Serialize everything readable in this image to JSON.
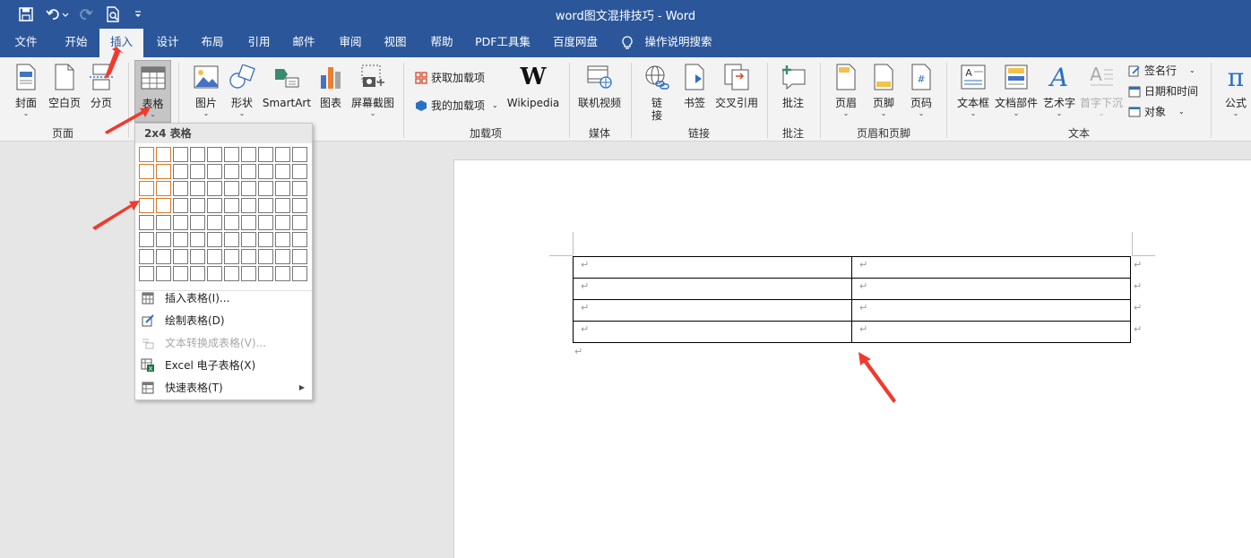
{
  "window": {
    "title": "word图文混排技巧 - Word"
  },
  "quick_access": {
    "items": [
      "save-icon",
      "undo-icon",
      "redo-icon",
      "print-preview-icon",
      "customize-icon"
    ]
  },
  "menu": {
    "tabs": [
      "文件",
      "开始",
      "插入",
      "设计",
      "布局",
      "引用",
      "邮件",
      "审阅",
      "视图",
      "帮助",
      "PDF工具集",
      "百度网盘"
    ],
    "active_tab": "插入",
    "tell_me": "操作说明搜索"
  },
  "ribbon": {
    "groups": {
      "pages": "页面",
      "addins": "加载项",
      "media": "媒体",
      "links": "链接",
      "comments": "批注",
      "header_footer": "页眉和页脚",
      "text": "文本"
    },
    "buttons": {
      "cover": "封面",
      "blank_page": "空白页",
      "page_break": "分页",
      "table": "表格",
      "picture": "图片",
      "shapes": "形状",
      "smartart": "SmartArt",
      "chart": "图表",
      "screenshot": "屏幕截图",
      "get_addins": "获取加载项",
      "my_addins": "我的加载项",
      "wikipedia": "Wikipedia",
      "online_video": "联机视频",
      "link": "链\n接",
      "bookmark": "书签",
      "cross_ref": "交叉引用",
      "comment": "批注",
      "header": "页眉",
      "footer": "页脚",
      "page_number": "页码",
      "text_box": "文本框",
      "quick_parts": "文档部件",
      "wordart": "艺术字",
      "drop_cap": "首字下沉",
      "signature": "签名行",
      "date_time": "日期和时间",
      "object": "对象",
      "equation": "公式"
    }
  },
  "table_dropdown": {
    "header": "2x4 表格",
    "grid_cols": 10,
    "grid_rows": 8,
    "selected_cols": 2,
    "selected_rows": 4,
    "items": [
      {
        "label": "插入表格(I)...",
        "icon": "insert-table-icon",
        "disabled": false
      },
      {
        "label": "绘制表格(D)",
        "icon": "draw-table-icon",
        "disabled": false
      },
      {
        "label": "文本转换成表格(V)...",
        "icon": "convert-text-icon",
        "disabled": true
      },
      {
        "label": "Excel 电子表格(X)",
        "icon": "excel-icon",
        "disabled": false
      },
      {
        "label": "快速表格(T)",
        "icon": "quick-table-icon",
        "disabled": false,
        "submenu": true
      }
    ]
  },
  "document": {
    "table_rows": 4,
    "table_cols": 2,
    "paragraph_mark": "↵"
  },
  "colors": {
    "title_bar": "#2b579a",
    "selection": "#d57a2b",
    "arrow": "#f03a2e"
  }
}
